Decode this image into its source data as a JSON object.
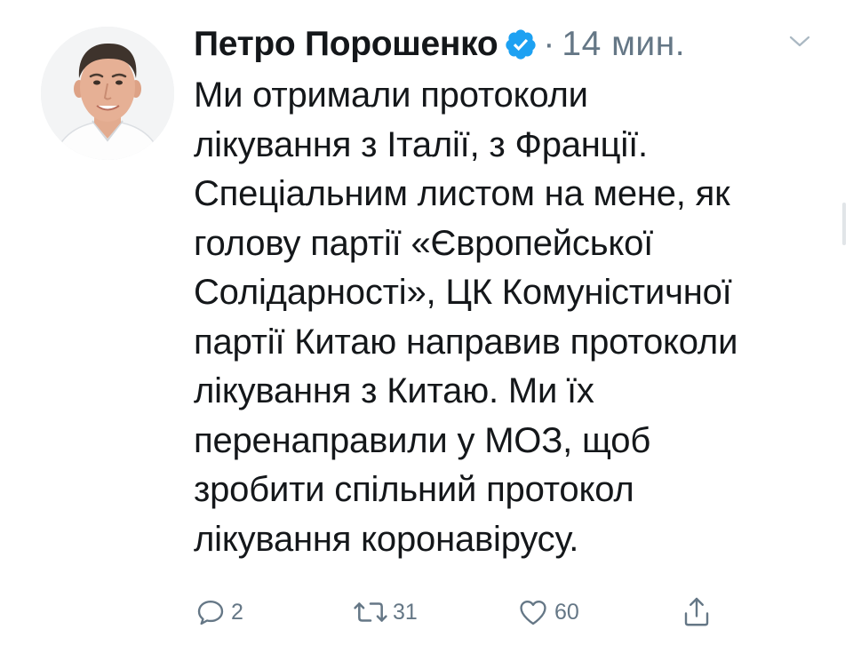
{
  "tweet": {
    "author_name": "Петро Порошенко",
    "separator": "·",
    "time": "14 мин.",
    "text_lines": [
      "Ми отримали протоколи",
      "лікування з Італії, з Франції.",
      "Спеціальним листом на мене, як",
      "голову партії «Європейської",
      "Солідарності», ЦК Комуністичної",
      "партії Китаю направив протоколи",
      "лікування з Китаю. Ми їх",
      "перенаправили у МОЗ, щоб",
      "зробити спільний протокол",
      "лікування коронавірусу."
    ],
    "actions": {
      "replies": "2",
      "retweets": "31",
      "likes": "60"
    }
  },
  "icons": {
    "verified": "verified-badge-icon",
    "menu": "chevron-down-icon",
    "reply": "reply-icon",
    "retweet": "retweet-icon",
    "like": "heart-icon",
    "share": "share-icon"
  },
  "colors": {
    "accent": "#1da1f2",
    "text": "#14171a",
    "muted": "#657786"
  }
}
